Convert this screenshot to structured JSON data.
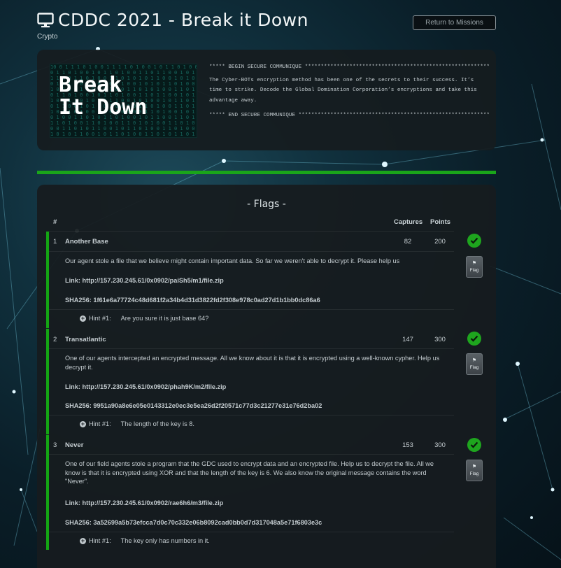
{
  "header": {
    "title": "CDDC 2021 - Break it Down",
    "category": "Crypto",
    "return_label": "Return to Missions"
  },
  "brief": {
    "image_text_line1": "Break",
    "image_text_line2": "It Down",
    "banner_begin": "***** BEGIN SECURE COMMUNIQUE ****************************************************************",
    "body": "The Cyber-BOTs encryption method has been one of the secrets to their success.  It’s time to strike. Decode the Global Domination Corporation’s encryptions and take this advantage away.",
    "banner_end": "***** END SECURE COMMUNIQUE ******************************************************************"
  },
  "flags": {
    "title": "- Flags -",
    "col_num": "#",
    "col_captures": "Captures",
    "col_points": "Points",
    "flag_button_label": "Flag",
    "items": [
      {
        "num": "1",
        "name": "Another Base",
        "captures": "82",
        "points": "200",
        "description": "Our agent stole a file that we believe might contain important data. So far we weren't able to decrypt it. Please help us",
        "link": "Link: http://157.230.245.61/0x0902/paiSh5/m1/file.zip",
        "sha": "SHA256: 1f61e6a77724c48d681f2a34b4d31d3822fd2f308e978c0ad27d1b1bb0dc86a6",
        "hint_label": "Hint #1:",
        "hint_text": "Are you sure it is just base 64?"
      },
      {
        "num": "2",
        "name": "Transatlantic",
        "captures": "147",
        "points": "300",
        "description": "One of our agents intercepted an encrypted message. All we know about it is that it is encrypted using a well-known cypher. Help us decrypt it.",
        "link": "Link: http://157.230.245.61/0x0902/phah9K/m2/file.zip",
        "sha": "SHA256: 9951a90a8e6e05e0143312e0ec3e5ea26d2f20571c77d3c21277e31e76d2ba02",
        "hint_label": "Hint #1:",
        "hint_text": "The length of the key is 8."
      },
      {
        "num": "3",
        "name": "Never",
        "captures": "153",
        "points": "300",
        "description": "One of our field agents stole a program that the GDC used to encrypt data and an encrypted file. Help us to decrypt the file. All we know is that it is encrypted using XOR and that the length of the key is 6. We also know the original message contains the word \"Never\".",
        "link": "Link: http://157.230.245.61/0x0902/rae6h6/m3/file.zip",
        "sha": "SHA256: 3a52699a5b73efcca7d0c70c332e06b8092cad0bb0d7d317048a5e71f6803e3c",
        "hint_label": "Hint #1:",
        "hint_text": "The key only has numbers in it."
      }
    ]
  }
}
